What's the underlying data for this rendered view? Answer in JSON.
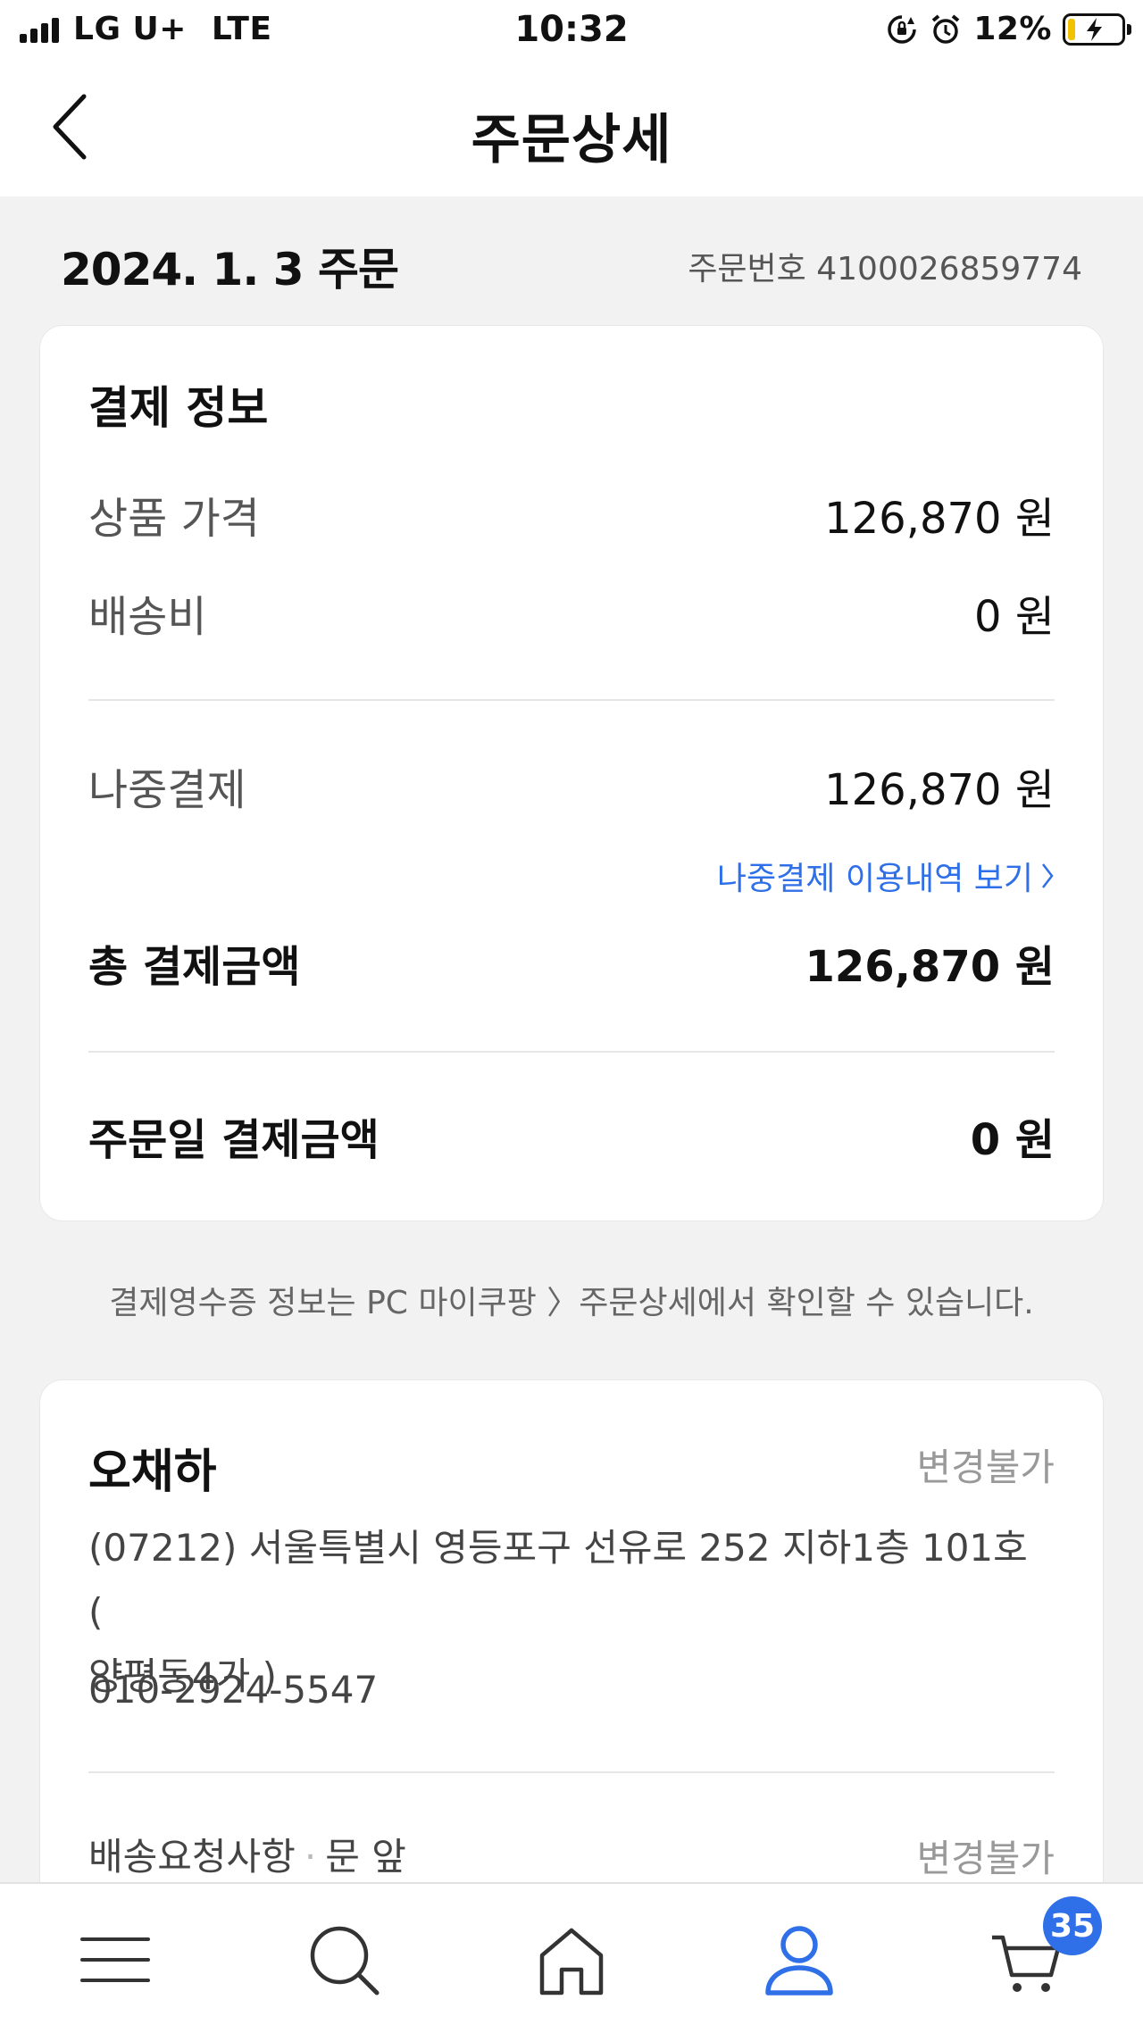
{
  "status_bar": {
    "carrier": "LG U+",
    "network": "LTE",
    "time": "10:32",
    "battery": "12%",
    "battery_level": 0.12
  },
  "header": {
    "title": "주문상세",
    "back_icon": "chevron-left-icon"
  },
  "order": {
    "date": "2024. 1. 3 주문",
    "number": "주문번호 4100026859774"
  },
  "payment": {
    "title": "결제 정보",
    "product_price_label": "상품 가격",
    "product_price_value": "126,870 원",
    "shipping_label": "배송비",
    "shipping_value": "0 원",
    "later_pay_label": "나중결제",
    "later_pay_value": "126,870 원",
    "later_pay_link": "나중결제 이용내역 보기",
    "total_label": "총 결제금액",
    "total_value": "126,870 원",
    "order_day_label": "주문일 결제금액",
    "order_day_value": "0 원"
  },
  "notice": "결제영수증 정보는 PC 마이쿠팡 〉주문상세에서 확인할 수 있습니다.",
  "shipping": {
    "name": "오채하",
    "change_label": "변경불가",
    "address_line1": "(07212) 서울특별시 영등포구 선유로 252 지하1층 101호 (",
    "address_line2": "양평동4가 )",
    "phone": "010-2924-5547",
    "request_label": "배송요청사항",
    "request_value": "문 앞",
    "request_change_label": "변경불가"
  },
  "bottom_nav": {
    "items": [
      "menu-icon",
      "search-icon",
      "home-icon",
      "my-page-icon",
      "cart-icon"
    ],
    "cart_count": "35",
    "active_color": "#2f6fe8"
  }
}
